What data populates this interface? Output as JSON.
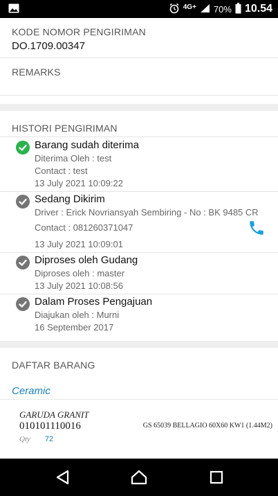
{
  "status_bar": {
    "left_icon": "image-icon",
    "network": "4G+",
    "battery": "70%",
    "time": "10.54"
  },
  "shipment": {
    "number_label": "KODE NOMOR PENGIRIMAN",
    "number": "DO.1709.00347",
    "remarks_label": "REMARKS",
    "remarks": ""
  },
  "history": {
    "title": "HISTORI PENGIRIMAN",
    "items": [
      {
        "title": "Barang sudah diterima",
        "status": "done",
        "lines": [
          "Diterima Oleh : test",
          "Contact : test",
          "13 July 2021 10:09:22"
        ]
      },
      {
        "title": "Sedang Dikirim",
        "status": "pending",
        "lines": [
          "Driver : Erick Novriansyah Sembiring - No : BK 9485 CR",
          "Contact : 081260371047",
          "13 July 2021 10:09:01"
        ]
      },
      {
        "title": "Diproses oleh Gudang",
        "status": "pending",
        "lines": [
          "Diproses oleh : master",
          "13 July 2021 10:08:56"
        ]
      },
      {
        "title": "Dalam Proses Pengajuan",
        "status": "pending",
        "lines": [
          "Diajukan oleh : Murni",
          "16 September 2017"
        ]
      }
    ]
  },
  "items": {
    "title": "DAFTAR BARANG",
    "category": "Ceramic",
    "product": {
      "brand": "GARUDA GRANIT",
      "code": "010101110016",
      "qty_label": "Qty",
      "qty": "72",
      "name": "GS 65039 BELLAGIO 60X60 KW1 (1.44M2)"
    }
  },
  "colors": {
    "done": "#2bb24c",
    "pending": "#757575",
    "accent": "#1a9fe0"
  }
}
